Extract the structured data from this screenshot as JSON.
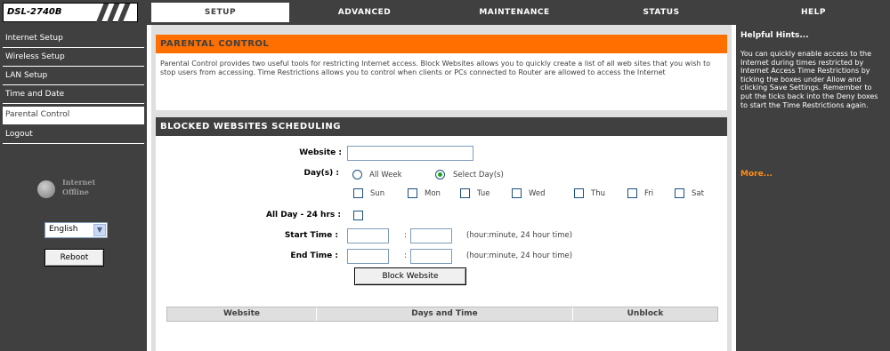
{
  "logo": {
    "model": "DSL-2740B"
  },
  "tabs": [
    {
      "label": "SETUP"
    },
    {
      "label": "ADVANCED"
    },
    {
      "label": "MAINTENANCE"
    },
    {
      "label": "STATUS"
    },
    {
      "label": "HELP"
    }
  ],
  "sidebar": {
    "items": [
      {
        "label": "Internet Setup"
      },
      {
        "label": "Wireless Setup"
      },
      {
        "label": "LAN Setup"
      },
      {
        "label": "Time and Date"
      },
      {
        "label": "Parental Control"
      },
      {
        "label": "Logout"
      }
    ],
    "status": "Internet Offline",
    "status_icon": "globe-icon",
    "language": "English",
    "reboot_label": "Reboot"
  },
  "parental": {
    "title": "PARENTAL CONTROL",
    "description": "Parental Control provides two useful tools for restricting Internet access. Block Websites allows you to quickly create a list of all web sites that you wish to stop users from accessing. Time Restrictions allows you to control when clients or PCs connected to Router are allowed to access the Internet"
  },
  "blocked": {
    "title": "BLOCKED WEBSITES SCHEDULING",
    "website_label": "Website :",
    "website_value": "",
    "days_label": "Day(s) :",
    "all_week_label": "All Week",
    "select_days_label": "Select Day(s)",
    "selected_option": "Select Day(s)",
    "days": [
      "Sun",
      "Mon",
      "Tue",
      "Wed",
      "Thu",
      "Fri",
      "Sat"
    ],
    "allday_label": "All Day - 24 hrs :",
    "start_label": "Start Time :",
    "end_label": "End Time :",
    "time_sep": ":",
    "time_hint": "(hour:minute, 24 hour time)",
    "button_label": "Block Website",
    "table_headers": [
      "Website",
      "Days and Time",
      "Unblock"
    ]
  },
  "help": {
    "title": "Helpful Hints...",
    "text": "You can quickly enable access to the Internet during times restricted by Internet Access Time Restrictions by ticking the boxes under Allow and clicking Save Settings. Remember to put the ticks back into the Deny boxes to start the Time Restrictions again.",
    "more_label": "More..."
  },
  "colors": {
    "chrome": "#404040",
    "accent": "#ff6f00",
    "panel": "#dfdfdf",
    "more_link": "#ff8c1a"
  }
}
